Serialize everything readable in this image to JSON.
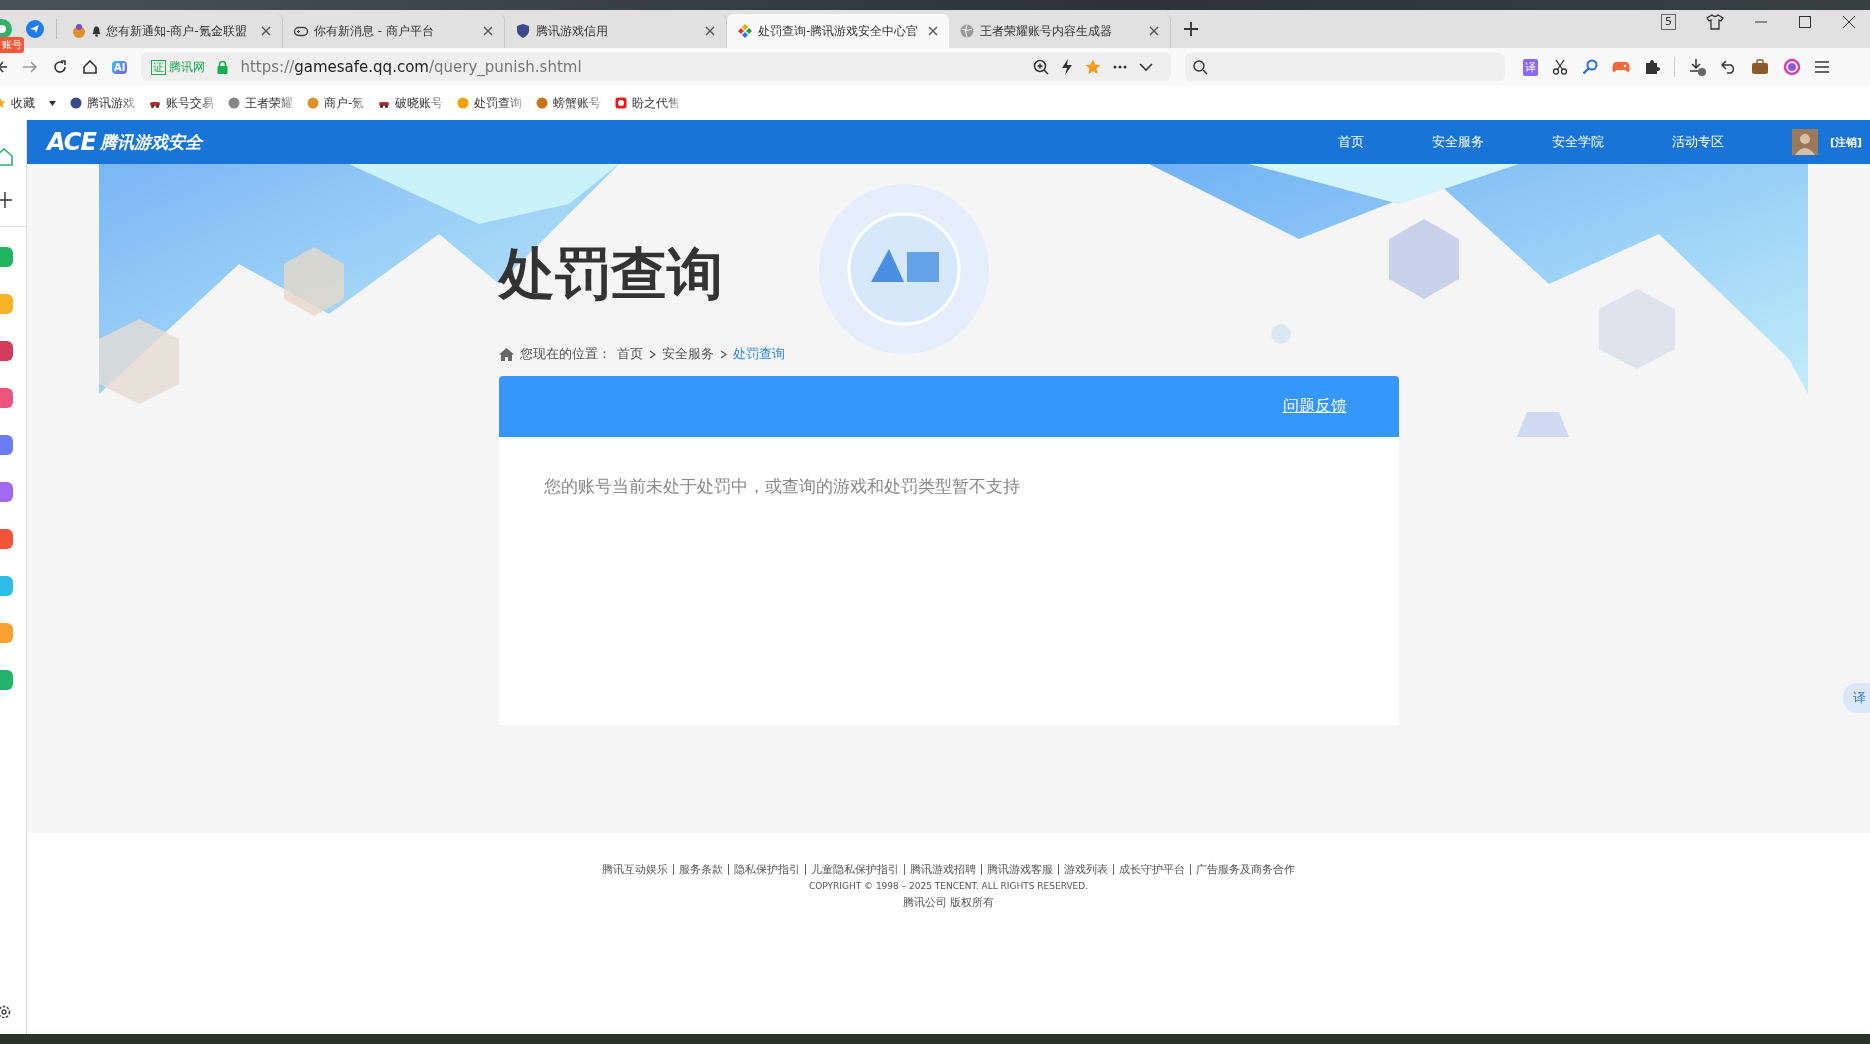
{
  "browser": {
    "sidebar_badge": "账号",
    "tabs": [
      {
        "title": "您有新通知-商户-氪金联盟",
        "kind": "mascot",
        "notification": true,
        "selected": false
      },
      {
        "title": "你有新消息 - 商户平台",
        "kind": "gamepad",
        "notification": false,
        "selected": false
      },
      {
        "title": "腾讯游戏信用",
        "kind": "shield",
        "notification": false,
        "selected": false
      },
      {
        "title": "处罚查询-腾讯游戏安全中心官",
        "kind": "diamond",
        "notification": false,
        "selected": true
      },
      {
        "title": "王者荣耀账号内容生成器",
        "kind": "globe",
        "notification": false,
        "selected": false
      }
    ],
    "tab_count": "5",
    "ai_button": "AI",
    "address": {
      "badge_mark": "证",
      "badge_label": "腾讯网",
      "url": "https://**gamesafe.qq.com**/query_punish.shtml"
    },
    "translate_button": "译",
    "bookmarks": [
      {
        "label": "收藏",
        "kind": "star"
      },
      {
        "label": "腾讯游戏",
        "kind": "shield"
      },
      {
        "label": "账号交易",
        "kind": "car"
      },
      {
        "label": "王者荣耀",
        "kind": "globe"
      },
      {
        "label": "商户-氪",
        "kind": "mascot"
      },
      {
        "label": "破晓账号",
        "kind": "car"
      },
      {
        "label": "处罚查询",
        "kind": "diamond"
      },
      {
        "label": "螃蟹账号",
        "kind": "crab"
      },
      {
        "label": "盼之代售",
        "kind": "red"
      }
    ]
  },
  "site": {
    "logo_mark": "ACE",
    "logo_text": "腾讯游戏安全",
    "nav": [
      {
        "label": "首页"
      },
      {
        "label": "安全服务"
      },
      {
        "label": "安全学院"
      },
      {
        "label": "活动专区"
      }
    ],
    "logout": "[注销]"
  },
  "page": {
    "title": "处罚查询",
    "breadcrumb_prefix": "您现在的位置：",
    "breadcrumb": [
      {
        "label": "首页",
        "current": false
      },
      {
        "label": "安全服务",
        "current": false
      },
      {
        "label": "处罚查询",
        "current": true
      }
    ],
    "feedback_link": "问题反馈",
    "message": "您的账号当前未处于处罚中，或查询的游戏和处罚类型暂不支持"
  },
  "footer": {
    "links": [
      "腾讯互动娱乐",
      "服务条款",
      "隐私保护指引",
      "儿童隐私保护指引",
      "腾讯游戏招聘",
      "腾讯游戏客服",
      "游戏列表",
      "成长守护平台",
      "广告服务及商务合作"
    ],
    "copyright": "COPYRIGHT © 1998 – 2025 TENCENT. ALL RIGHTS RESERVED.",
    "company": "腾讯公司 版权所有"
  },
  "float_button": "译"
}
